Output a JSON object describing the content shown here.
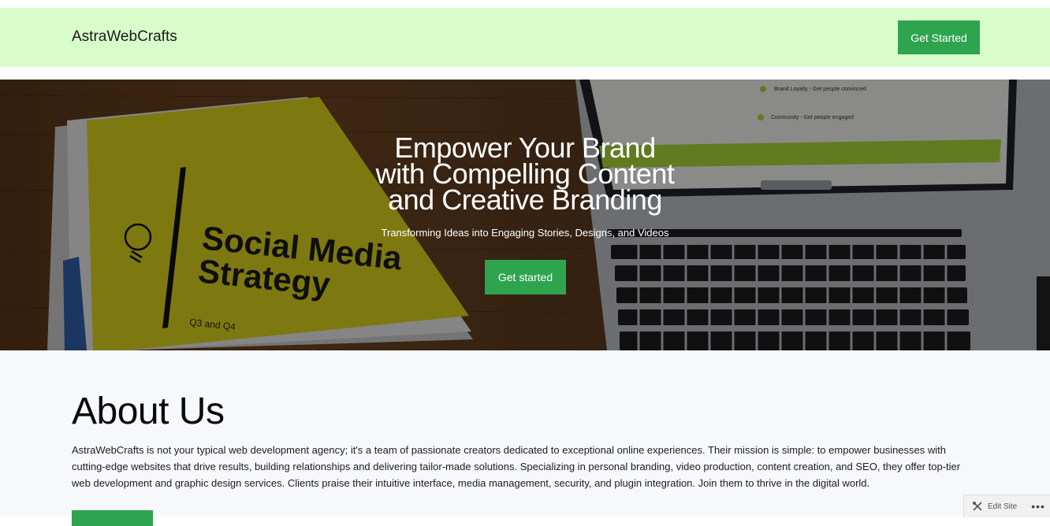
{
  "header": {
    "brand": "AstraWebCrafts",
    "cta_label": "Get Started"
  },
  "hero": {
    "title_lines": [
      "Empower Your Brand",
      "with Compelling Content",
      "and Creative Branding"
    ],
    "subtitle": "Transforming Ideas into Engaging Stories, Designs, and Videos",
    "cta_label": "Get started",
    "image": {
      "book_title_line1": "Social Media",
      "book_title_line2": "Strategy",
      "book_footer": "Q3 and Q4",
      "screen_line1": "Brand Loyalty - Get people convinced",
      "screen_line2": "Community - Get people engaged"
    }
  },
  "about": {
    "title": "About Us",
    "body": "AstraWebCrafts is not your typical web development agency; it's a team of passionate creators dedicated to exceptional online experiences. Their mission is simple: to empower businesses with cutting-edge websites that drive results, building relationships and delivering tailor-made solutions. Specializing in personal branding, video production, content creation, and SEO, they offer top-tier web development and graphic design services. Clients praise their intuitive interface, media management, security, and plugin integration. Join them to thrive in the digital world."
  },
  "admin_bar": {
    "edit_label": "Edit Site",
    "more_icon": "more-dots-icon"
  },
  "colors": {
    "header_bg": "#d8fdcb",
    "button_green": "#2ea44f",
    "about_bg": "#f7f8fc"
  }
}
